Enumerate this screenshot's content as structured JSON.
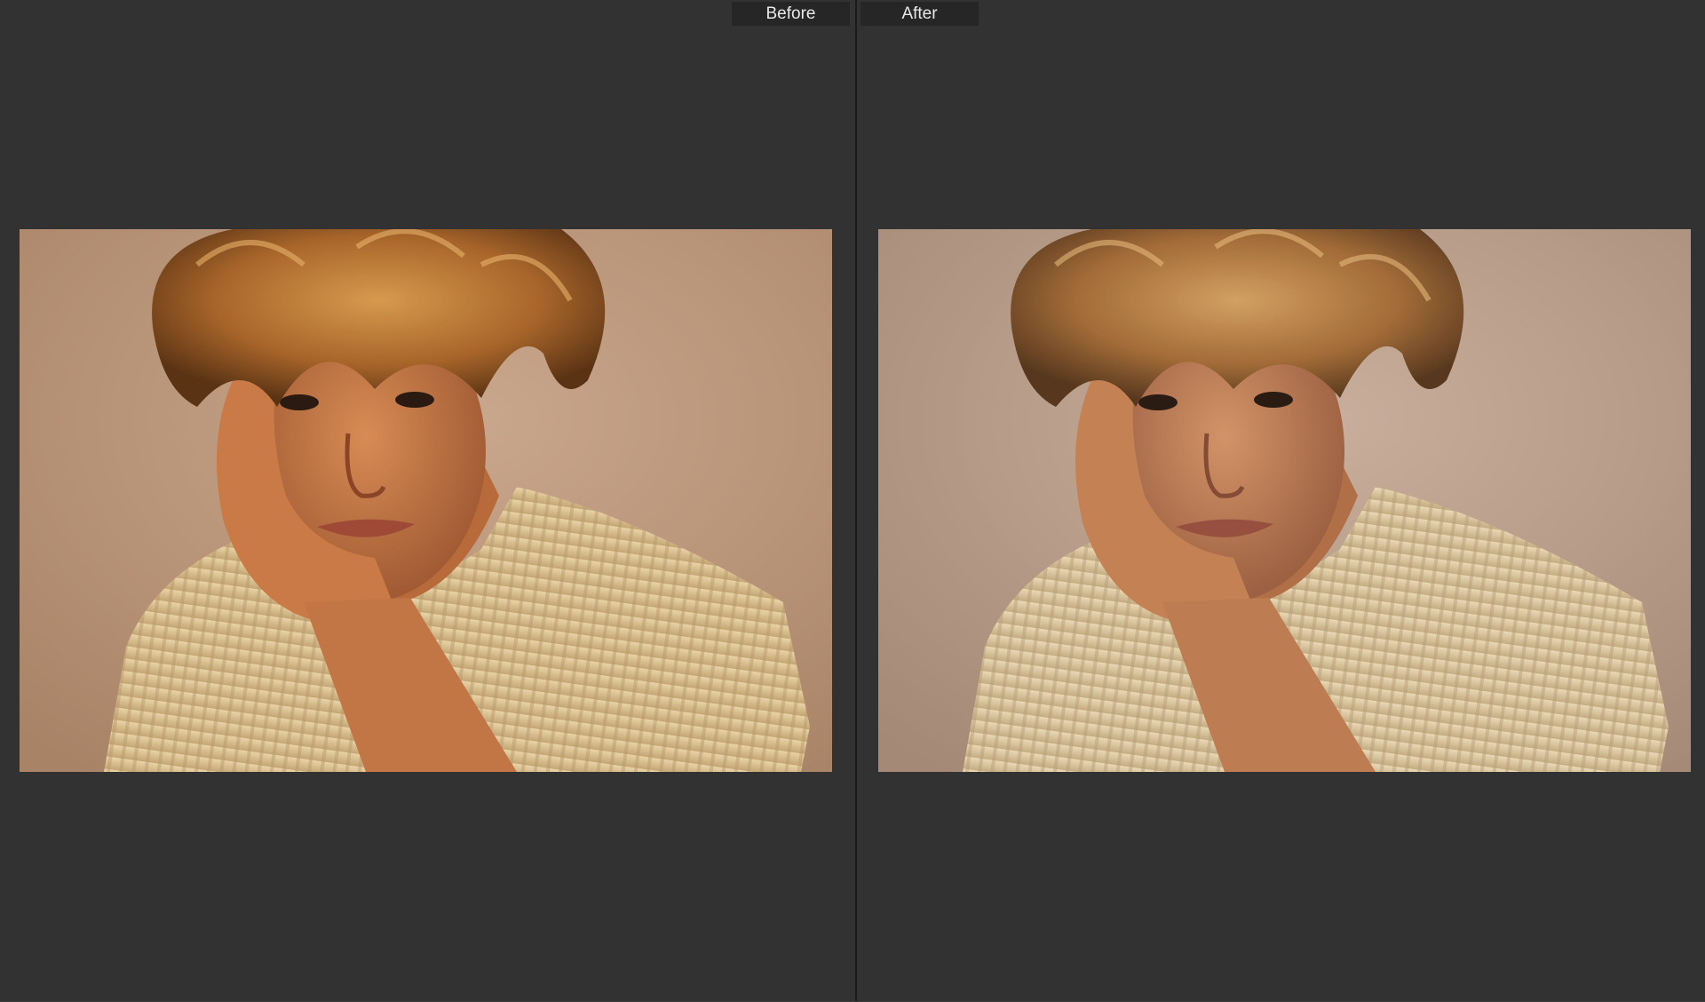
{
  "compare": {
    "before_label": "Before",
    "after_label": "After"
  },
  "colors": {
    "background": "#323232",
    "label_bg": "#262626",
    "label_text": "#e8e8e8",
    "divider": "#1a1a1a"
  }
}
